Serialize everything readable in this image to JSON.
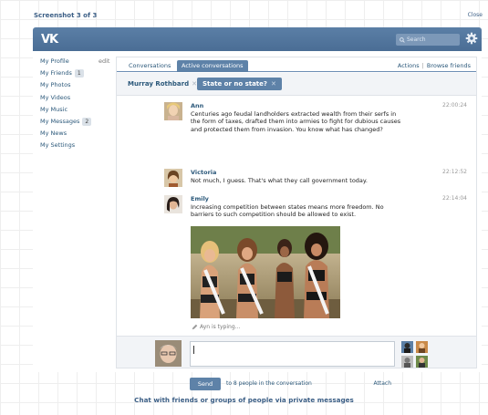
{
  "screenshot_label": "Screenshot 3 of 3",
  "close_label": "Close",
  "header": {
    "logo": "VK",
    "search_placeholder": "Search"
  },
  "sidebar": {
    "items": [
      {
        "label": "My Profile",
        "count": "",
        "extra": "edit"
      },
      {
        "label": "My Friends",
        "count": "1",
        "extra": ""
      },
      {
        "label": "My Photos",
        "count": "",
        "extra": ""
      },
      {
        "label": "My Videos",
        "count": "",
        "extra": ""
      },
      {
        "label": "My Music",
        "count": "",
        "extra": ""
      },
      {
        "label": "My Messages",
        "count": "2",
        "extra": ""
      },
      {
        "label": "My News",
        "count": "",
        "extra": ""
      },
      {
        "label": "My Settings",
        "count": "",
        "extra": ""
      }
    ]
  },
  "tabs": {
    "conversations": "Conversations",
    "active": "Active conversations",
    "actions": "Actions",
    "separator": "|",
    "browse": "Browse friends"
  },
  "conversation_bar": {
    "person": "Murray Rothbard",
    "topic": "State or no state?",
    "remove": "✕"
  },
  "messages": [
    {
      "name": "Ann",
      "time": "22:00:24",
      "text": "Centuries ago feudal landholders extracted wealth from their serfs in the form of taxes, drafted them into armies to fight for dubious causes and protected them from invasion. You know what has changed?"
    },
    {
      "name": "Victoria",
      "time": "22:12:52",
      "text": "Not much, I guess. That's what they call government today."
    },
    {
      "name": "Emily",
      "time": "22:14:04",
      "text": "Increasing competition between states means more freedom. No barriers to such competition should be allowed to exist."
    }
  ],
  "typing": "Ayn is typing...",
  "compose": {
    "send": "Send",
    "note": "to 8 people in the conversation",
    "attach": "Attach"
  },
  "caption": "Chat with friends or groups of people via private messages",
  "colors": {
    "header": "#5b7fa6",
    "link": "#2b587a",
    "accent": "#5e82a8"
  }
}
